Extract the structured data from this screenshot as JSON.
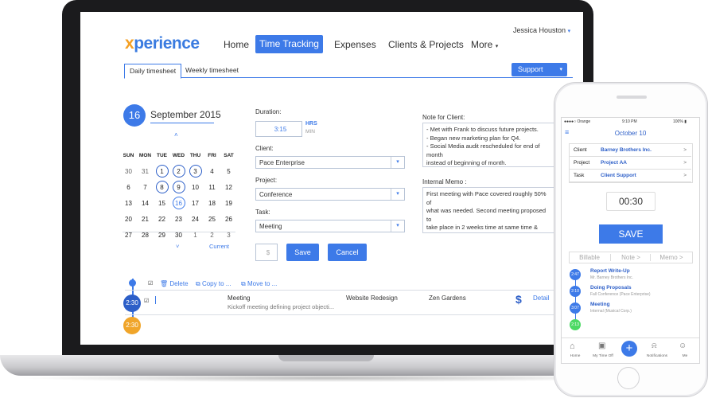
{
  "app": {
    "logo": {
      "x": "x",
      "rest": "perience"
    },
    "nav": {
      "home": "Home",
      "active": "Time Tracking",
      "expenses": "Expenses",
      "clients": "Clients & Projects",
      "more": "More"
    },
    "user": "Jessica Houston",
    "tabs": {
      "daily": "Daily timesheet",
      "weekly": "Weekly timesheet"
    },
    "support": "Support",
    "calendar": {
      "day": "16",
      "month": "September 2015",
      "weekdays": [
        "SUN",
        "MON",
        "TUE",
        "WED",
        "THU",
        "FRI",
        "SAT"
      ],
      "weeks": [
        [
          "30",
          "31",
          "1",
          "2",
          "3",
          "4",
          "5"
        ],
        [
          "6",
          "7",
          "8",
          "9",
          "10",
          "11",
          "12"
        ],
        [
          "13",
          "14",
          "15",
          "16",
          "17",
          "18",
          "19"
        ],
        [
          "20",
          "21",
          "22",
          "23",
          "24",
          "25",
          "26"
        ],
        [
          "27",
          "28",
          "29",
          "30",
          "1",
          "2",
          "3"
        ]
      ],
      "current": "Current"
    },
    "form": {
      "duration_label": "Duration:",
      "duration_value": "3:15",
      "hrs": "HRS",
      "min": "MIN",
      "client_label": "Client:",
      "client_value": "Pace Enterprise",
      "project_label": "Project:",
      "project_value": "Conference",
      "task_label": "Task:",
      "task_value": "Meeting",
      "dollar": "$",
      "save": "Save",
      "cancel": "Cancel"
    },
    "notes": {
      "client_label": "Note for Client:",
      "client_lines": [
        "- Met with Frank to discuss future projects.",
        "- Began new marketing plan for Q4.",
        "- Social Media audit rescheduled for end of month",
        "instead of beginning of month."
      ],
      "memo_label": "Internal Memo :",
      "memo_lines": [
        "First meeting with Pace covered roughly 50% of",
        "what was needed. Second meeting proposed to",
        "take place in 2 weeks time at same time & venue."
      ]
    },
    "actions": {
      "delete": "Delete",
      "copy": "Copy to ...",
      "move": "Move to ..."
    },
    "entry": {
      "time": "2:30",
      "task": "Meeting",
      "desc": "Kickoff meeting defining project objecti...",
      "project": "Website Redesign",
      "client": "Zen Gardens",
      "dollar": "$",
      "detail": "Detail",
      "time2": "2:30"
    }
  },
  "phone": {
    "carrier": "Orange",
    "clock": "9:10 PM",
    "battery": "100%",
    "date": "October 10",
    "rows": [
      {
        "label": "Client",
        "value": "Barney Brothers Inc."
      },
      {
        "label": "Project",
        "value": "Project AA"
      },
      {
        "label": "Task",
        "value": "Client Support"
      }
    ],
    "timer": "00:30",
    "save": "SAVE",
    "tabs": [
      "Billable",
      "Note",
      "Memo"
    ],
    "entries": [
      {
        "time": "2:47",
        "title": "Report Write-Up",
        "sub": "Mr. Barney Brothers Inc."
      },
      {
        "time": "2:10",
        "title": "Doing Proposals",
        "sub": "Fall Conference (Pace Enterprise)"
      },
      {
        "time": "3:07",
        "title": "Meeting",
        "sub": "Internal (Musical Corp.)"
      },
      {
        "time": "2:13",
        "title": "",
        "sub": ""
      }
    ],
    "nav": [
      "Home",
      "My Time Off",
      "",
      "Notifications",
      "Me"
    ],
    "colors": {
      "accent": "#3d7ae8",
      "orange": "#f4a024",
      "green": "#4cd964"
    }
  }
}
